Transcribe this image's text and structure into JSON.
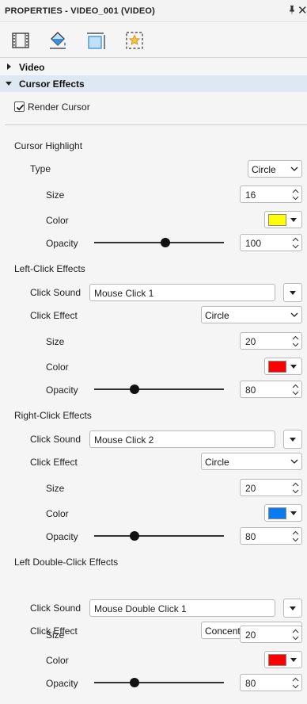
{
  "title": "PROPERTIES - VIDEO_001 (VIDEO)",
  "tabs": [
    {
      "name": "tab-visual-properties",
      "icon": "film-frame-icon"
    },
    {
      "name": "tab-color",
      "icon": "paint-bucket-icon"
    },
    {
      "name": "tab-size",
      "icon": "resize-frame-icon"
    },
    {
      "name": "tab-effects",
      "icon": "star-frame-icon"
    }
  ],
  "sections": {
    "video": "Video",
    "cursor_effects": "Cursor Effects"
  },
  "render_cursor": {
    "label": "Render Cursor",
    "checked": true
  },
  "labels": {
    "type": "Type",
    "size": "Size",
    "color": "Color",
    "opacity": "Opacity",
    "click_sound": "Click Sound",
    "click_effect": "Click Effect"
  },
  "highlight": {
    "heading": "Cursor Highlight",
    "type": "Circle",
    "size": "16",
    "color": "#ffff00",
    "opacity": "100",
    "slider_level": 0.55
  },
  "left_click": {
    "heading": "Left-Click Effects",
    "sound": "Mouse Click 1",
    "effect": "Circle",
    "size": "20",
    "color": "#ff0000",
    "opacity": "80",
    "slider_level": 0.31
  },
  "right_click": {
    "heading": "Right-Click Effects",
    "sound": "Mouse Click 2",
    "effect": "Circle",
    "size": "20",
    "color": "#0a7cf0",
    "opacity": "80",
    "slider_level": 0.31
  },
  "double_click": {
    "heading": "Left Double-Click Effects",
    "sound": "Mouse Double Click 1",
    "effect": "Concentric Circles",
    "size": "20",
    "color": "#ff0000",
    "opacity": "80",
    "slider_level": 0.31
  },
  "colors": {
    "section_selected_bg": "#dde8f3",
    "tab_icon_blue": "#3a8fd8"
  }
}
